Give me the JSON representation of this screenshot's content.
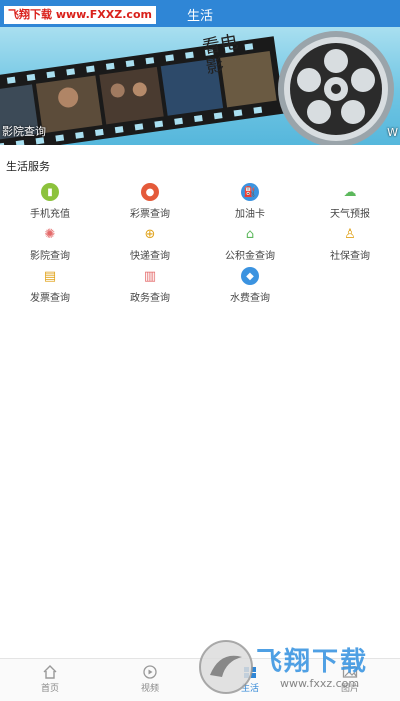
{
  "header": {
    "title": "生活"
  },
  "watermark_top": "飞翔下载 www.FXXZ.com",
  "banner": {
    "caption": "影院查询",
    "caption_right": "W",
    "art_text": "看电影"
  },
  "section": {
    "title": "生活服务"
  },
  "services": [
    {
      "label": "手机充值",
      "icon": "phone-recharge-icon",
      "color": "#8cc23c"
    },
    {
      "label": "彩票查询",
      "icon": "lottery-icon",
      "color": "#e45a3a"
    },
    {
      "label": "加油卡",
      "icon": "fuel-card-icon",
      "color": "#3b93e0"
    },
    {
      "label": "天气预报",
      "icon": "weather-icon",
      "color": "#5cb85c"
    },
    {
      "label": "影院查询",
      "icon": "cinema-icon",
      "color": "#e46a6a"
    },
    {
      "label": "快递查询",
      "icon": "express-icon",
      "color": "#e0a21a"
    },
    {
      "label": "公积金查询",
      "icon": "housing-fund-icon",
      "color": "#5cb85c"
    },
    {
      "label": "社保查询",
      "icon": "social-security-icon",
      "color": "#e0a21a"
    },
    {
      "label": "发票查询",
      "icon": "invoice-icon",
      "color": "#e0a21a"
    },
    {
      "label": "政务查询",
      "icon": "government-icon",
      "color": "#e46a6a"
    },
    {
      "label": "水费查询",
      "icon": "water-bill-icon",
      "color": "#3b93e0"
    }
  ],
  "tabs": [
    {
      "label": "首页",
      "icon": "home-icon"
    },
    {
      "label": "视频",
      "icon": "video-icon"
    },
    {
      "label": "生活",
      "icon": "life-icon",
      "active": true
    },
    {
      "label": "图片",
      "icon": "image-icon"
    }
  ],
  "watermark_bottom": {
    "main": "飞翔下载",
    "sub": "www.fxxz.com"
  },
  "colors": {
    "primary": "#2f86d6",
    "watermark_red": "#d9211b"
  }
}
